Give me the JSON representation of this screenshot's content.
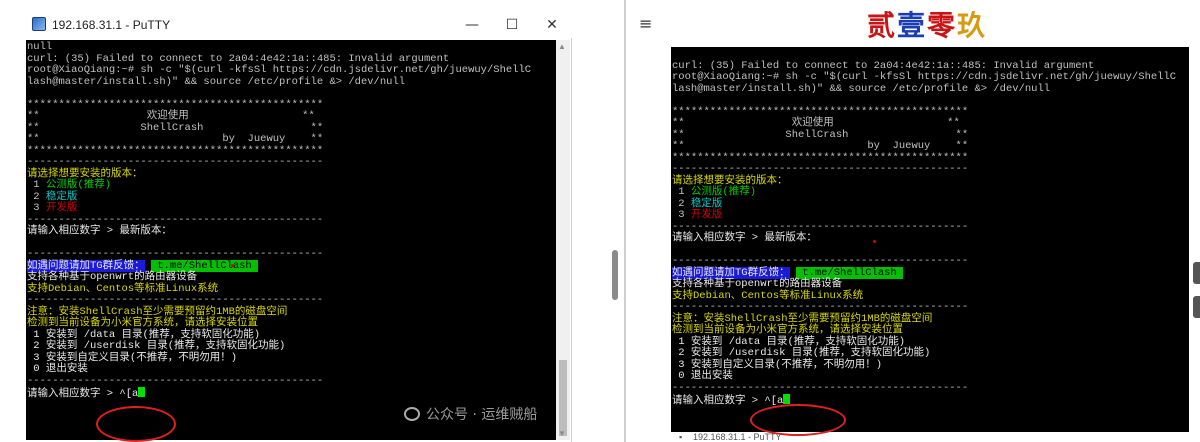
{
  "left_window": {
    "title": "192.168.31.1 - PuTTY",
    "minimize": "—",
    "maximize": "☐",
    "close": "✕"
  },
  "right_window": {
    "menu_icon": "≡",
    "brand": [
      "贰",
      "壹",
      "零",
      "玖"
    ],
    "bottom_label": "192.168.31.1 - PuTTY"
  },
  "watermark": "公众号 · 运维贼船",
  "terminal_left": [
    [
      {
        "t": "null",
        "c": "c-def"
      }
    ],
    [
      {
        "t": "curl: (35) Failed to connect to 2a04:4e42:1a::485: Invalid argument",
        "c": "c-def"
      }
    ],
    [
      {
        "t": "root@XiaoQiang:~# sh -c \"$(curl -kfsSl https://cdn.jsdelivr.net/gh/juewuy/ShellC",
        "c": "c-def"
      }
    ],
    [
      {
        "t": "lash@master/install.sh)\" && source /etc/profile &> /dev/null",
        "c": "c-def"
      }
    ],
    [
      {
        "t": "",
        "c": "c-def"
      }
    ],
    [
      {
        "t": "***********************************************",
        "c": "c-def"
      }
    ],
    [
      {
        "t": "**                 欢迎使用                  **",
        "c": "c-def"
      }
    ],
    [
      {
        "t": "**                ShellCrash                 **",
        "c": "c-def"
      }
    ],
    [
      {
        "t": "**                             by  Juewuy    **",
        "c": "c-def"
      }
    ],
    [
      {
        "t": "***********************************************",
        "c": "c-def"
      }
    ],
    [
      {
        "t": "-----------------------------------------------",
        "c": "c-def"
      }
    ],
    [
      {
        "t": "请选择想要安装的版本：",
        "c": "c-yellow"
      }
    ],
    [
      {
        "t": " 1 ",
        "c": "c-def"
      },
      {
        "t": "公测版(推荐)",
        "c": "c-green"
      }
    ],
    [
      {
        "t": " 2 ",
        "c": "c-def"
      },
      {
        "t": "稳定版",
        "c": "c-cyan"
      }
    ],
    [
      {
        "t": " 3 ",
        "c": "c-def"
      },
      {
        "t": "开发版",
        "c": "c-red"
      }
    ],
    [
      {
        "t": "-----------------------------------------------",
        "c": "c-def"
      }
    ],
    [
      {
        "t": "请输入相应数字 > 最新版本：",
        "c": "c-white"
      }
    ],
    [
      {
        "t": "",
        "c": "c-def"
      }
    ],
    [
      {
        "t": "-----------------------------------------------",
        "c": "c-def"
      }
    ],
    [
      {
        "t": "如遇问题请加TG群反馈：",
        "c": "hl-blue"
      },
      {
        "t": " ",
        "c": "c-def"
      },
      {
        "t": " t.me/ShellClash ",
        "c": "hl-green"
      }
    ],
    [
      {
        "t": "支持各种基于openwrt的路由器设备",
        "c": "c-white"
      }
    ],
    [
      {
        "t": "支持Debian、Centos等标准Linux系统",
        "c": "c-yellow"
      }
    ],
    [
      {
        "t": "-----------------------------------------------",
        "c": "c-def"
      }
    ],
    [
      {
        "t": "注意：安装ShellCrash至少需要预留约1MB的磁盘空间",
        "c": "c-yellow"
      }
    ],
    [
      {
        "t": "检测到当前设备为小米官方系统，请选择安装位置",
        "c": "c-yellow"
      }
    ],
    [
      {
        "t": " 1 安装到 /data 目录(推荐，支持软固化功能)",
        "c": "c-white"
      }
    ],
    [
      {
        "t": " 2 安装到 /userdisk 目录(推荐，支持软固化功能)",
        "c": "c-white"
      }
    ],
    [
      {
        "t": " 3 安装到自定义目录(不推荐，不明勿用！)",
        "c": "c-white"
      }
    ],
    [
      {
        "t": " 0 退出安装",
        "c": "c-white"
      }
    ],
    [
      {
        "t": "-----------------------------------------------",
        "c": "c-def"
      }
    ],
    [
      {
        "t": "请输入相应数字 > ^[a",
        "c": "c-white"
      },
      {
        "t": "CURSOR",
        "c": "cursor"
      }
    ]
  ],
  "terminal_right": [
    [
      {
        "t": "",
        "c": "c-def"
      }
    ],
    [
      {
        "t": "curl: (35) Failed to connect to 2a04:4e42:1a::485: Invalid argument",
        "c": "c-def"
      }
    ],
    [
      {
        "t": "root@XiaoQiang:~# sh -c \"$(curl -kfsSl https://cdn.jsdelivr.net/gh/juewuy/ShellC",
        "c": "c-def"
      }
    ],
    [
      {
        "t": "lash@master/install.sh)\" && source /etc/profile &> /dev/null",
        "c": "c-def"
      }
    ],
    [
      {
        "t": "",
        "c": "c-def"
      }
    ],
    [
      {
        "t": "***********************************************",
        "c": "c-def"
      }
    ],
    [
      {
        "t": "**                 欢迎使用                  **",
        "c": "c-def"
      }
    ],
    [
      {
        "t": "**                ShellCrash                 **",
        "c": "c-def"
      }
    ],
    [
      {
        "t": "**                             by  Juewuy    **",
        "c": "c-def"
      }
    ],
    [
      {
        "t": "***********************************************",
        "c": "c-def"
      }
    ],
    [
      {
        "t": "-----------------------------------------------",
        "c": "c-def"
      }
    ],
    [
      {
        "t": "请选择想要安装的版本：",
        "c": "c-yellow"
      }
    ],
    [
      {
        "t": " 1 ",
        "c": "c-def"
      },
      {
        "t": "公测版(推荐)",
        "c": "c-green"
      }
    ],
    [
      {
        "t": " 2 ",
        "c": "c-def"
      },
      {
        "t": "稳定版",
        "c": "c-cyan"
      }
    ],
    [
      {
        "t": " 3 ",
        "c": "c-def"
      },
      {
        "t": "开发版",
        "c": "c-red"
      }
    ],
    [
      {
        "t": "-----------------------------------------------",
        "c": "c-def"
      }
    ],
    [
      {
        "t": "请输入相应数字 > 最新版本：",
        "c": "c-white"
      }
    ],
    [
      {
        "t": "",
        "c": "c-def"
      }
    ],
    [
      {
        "t": "-----------------------------------------------",
        "c": "c-def"
      }
    ],
    [
      {
        "t": "如遇问题请加TG群反馈：",
        "c": "hl-blue"
      },
      {
        "t": " ",
        "c": "c-def"
      },
      {
        "t": " t.me/ShellClash ",
        "c": "hl-green"
      }
    ],
    [
      {
        "t": "支持各种基于openwrt的路由器设备",
        "c": "c-white"
      }
    ],
    [
      {
        "t": "支持Debian、Centos等标准Linux系统",
        "c": "c-yellow"
      }
    ],
    [
      {
        "t": "-----------------------------------------------",
        "c": "c-def"
      }
    ],
    [
      {
        "t": "注意：安装ShellCrash至少需要预留约1MB的磁盘空间",
        "c": "c-yellow"
      }
    ],
    [
      {
        "t": "检测到当前设备为小米官方系统，请选择安装位置",
        "c": "c-yellow"
      }
    ],
    [
      {
        "t": " 1 安装到 /data 目录(推荐，支持软固化功能)",
        "c": "c-white"
      }
    ],
    [
      {
        "t": " 2 安装到 /userdisk 目录(推荐，支持软固化功能)",
        "c": "c-white"
      }
    ],
    [
      {
        "t": " 3 安装到自定义目录(不推荐，不明勿用！)",
        "c": "c-white"
      }
    ],
    [
      {
        "t": " 0 退出安装",
        "c": "c-white"
      }
    ],
    [
      {
        "t": "-----------------------------------------------",
        "c": "c-def"
      }
    ],
    [
      {
        "t": "请输入相应数字 > ^[a",
        "c": "c-white"
      },
      {
        "t": "CURSOR",
        "c": "cursor"
      }
    ]
  ]
}
